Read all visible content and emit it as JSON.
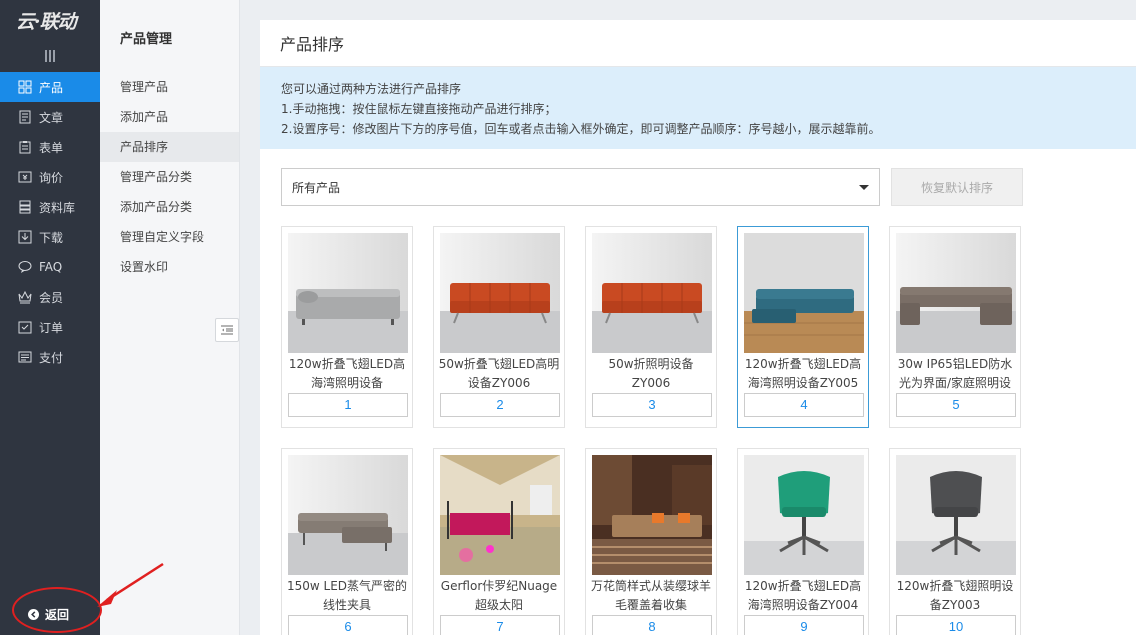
{
  "rail": {
    "logo": "云·联动",
    "items": [
      {
        "label": "产品",
        "icon": "grid-icon",
        "active": true
      },
      {
        "label": "文章",
        "icon": "document-icon"
      },
      {
        "label": "表单",
        "icon": "clipboard-icon"
      },
      {
        "label": "询价",
        "icon": "price-tag-icon"
      },
      {
        "label": "资料库",
        "icon": "database-icon"
      },
      {
        "label": "下载",
        "icon": "download-icon"
      },
      {
        "label": "FAQ",
        "icon": "chat-bubble-icon"
      },
      {
        "label": "会员",
        "icon": "crown-icon"
      },
      {
        "label": "订单",
        "icon": "checklist-icon"
      },
      {
        "label": "支付",
        "icon": "card-icon"
      }
    ],
    "back_label": "返回"
  },
  "subnav": {
    "title": "产品管理",
    "items": [
      {
        "label": "管理产品"
      },
      {
        "label": "添加产品"
      },
      {
        "label": "产品排序",
        "active": true
      },
      {
        "label": "管理产品分类"
      },
      {
        "label": "添加产品分类"
      },
      {
        "label": "管理自定义字段"
      },
      {
        "label": "设置水印"
      }
    ]
  },
  "main": {
    "title": "产品排序",
    "tips": [
      "您可以通过两种方法进行产品排序",
      "1.手动拖拽：按住鼠标左键直接拖动产品进行排序；",
      "2.设置序号：修改图片下方的序号值，回车或者点击输入框外确定，即可调整产品顺序：序号越小，展示越靠前。"
    ],
    "filter_selected": "所有产品",
    "reset_button": "恢复默认排序"
  },
  "products": [
    {
      "name": "120w折叠飞翅LED高海湾照明设备",
      "order": "1",
      "scene": "daybed"
    },
    {
      "name": "50w折叠飞翅LED高明设备ZY006",
      "order": "2",
      "scene": "orange-sofa"
    },
    {
      "name": "50w折照明设备ZY006",
      "order": "3",
      "scene": "orange-sofa"
    },
    {
      "name": "120w折叠飞翅LED高海湾照明设备ZY005",
      "order": "4",
      "scene": "teal-sectional",
      "selected": true
    },
    {
      "name": "30w IP65铝LED防水光为界面/家庭照明设",
      "order": "5",
      "scene": "u-sectional"
    },
    {
      "name": "150w LED蒸气严密的线性夹具",
      "order": "6",
      "scene": "chaise"
    },
    {
      "name": "Gerflor佧罗纪Nuage超级太阳",
      "order": "7",
      "scene": "bedroom"
    },
    {
      "name": "万花筒样式从装缨球羊毛覆盖着收集",
      "order": "8",
      "scene": "livingroom"
    },
    {
      "name": "120w折叠飞翅LED高海湾照明设备ZY004",
      "order": "9",
      "scene": "green-chair"
    },
    {
      "name": "120w折叠飞翅照明设备ZY003",
      "order": "10",
      "scene": "grey-chair"
    }
  ],
  "colors": {
    "accent": "#1a8be8",
    "rail_bg": "#2f3540",
    "tips_bg": "#dceefb",
    "annotation_red": "#e02020"
  }
}
